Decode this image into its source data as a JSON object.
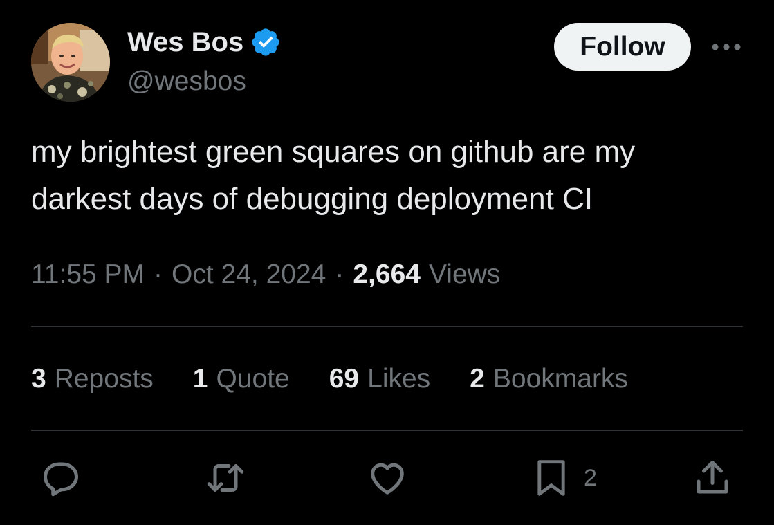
{
  "author": {
    "display_name": "Wes Bos",
    "handle": "@wesbos",
    "verified": true,
    "avatar_icon": "profile-photo"
  },
  "header": {
    "follow_label": "Follow",
    "more_icon": "more-dots-icon"
  },
  "tweet": {
    "text_lines": [
      "my brightest green squares on github are my",
      "darkest days of debugging deployment CI"
    ]
  },
  "meta": {
    "time": "11:55 PM",
    "separator": "·",
    "date": "Oct 24, 2024",
    "views_count": "2,664",
    "views_label": "Views"
  },
  "stats": [
    {
      "count": "3",
      "label": "Reposts"
    },
    {
      "count": "1",
      "label": "Quote"
    },
    {
      "count": "69",
      "label": "Likes"
    },
    {
      "count": "2",
      "label": "Bookmarks"
    }
  ],
  "actions": {
    "reply_icon": "reply-icon",
    "repost_icon": "repost-icon",
    "like_icon": "heart-icon",
    "bookmark_icon": "bookmark-icon",
    "bookmark_count": "2",
    "share_icon": "share-icon"
  },
  "colors": {
    "background": "#000000",
    "primary_text": "#e7e9ea",
    "secondary_text": "#71767b",
    "divider": "#2f3336",
    "verified_badge": "#1d9bf0",
    "follow_button_bg": "#eff3f4"
  }
}
